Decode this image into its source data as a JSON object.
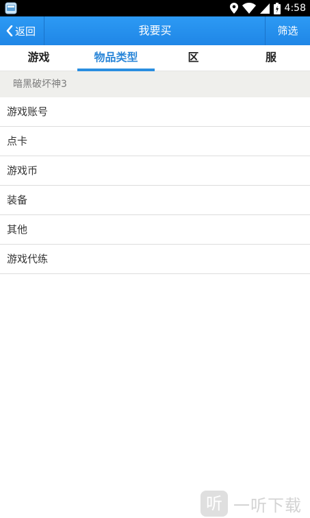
{
  "status_bar": {
    "time": "4:58"
  },
  "title_bar": {
    "back_label": "返回",
    "title": "我要买",
    "filter_label": "筛选"
  },
  "tabs": [
    {
      "label": "游戏",
      "active": false
    },
    {
      "label": "物品类型",
      "active": true
    },
    {
      "label": "区",
      "active": false
    },
    {
      "label": "服",
      "active": false
    }
  ],
  "selected_game": "暗黑破坏神3",
  "item_types": [
    "游戏账号",
    "点卡",
    "游戏币",
    "装备",
    "其他",
    "游戏代练"
  ],
  "watermark": {
    "logo_text": "听",
    "text": "一听下载"
  },
  "colors": {
    "title_bar": "#1f86e6",
    "tab_active": "#2a86d8",
    "header_bg": "#efefec"
  }
}
